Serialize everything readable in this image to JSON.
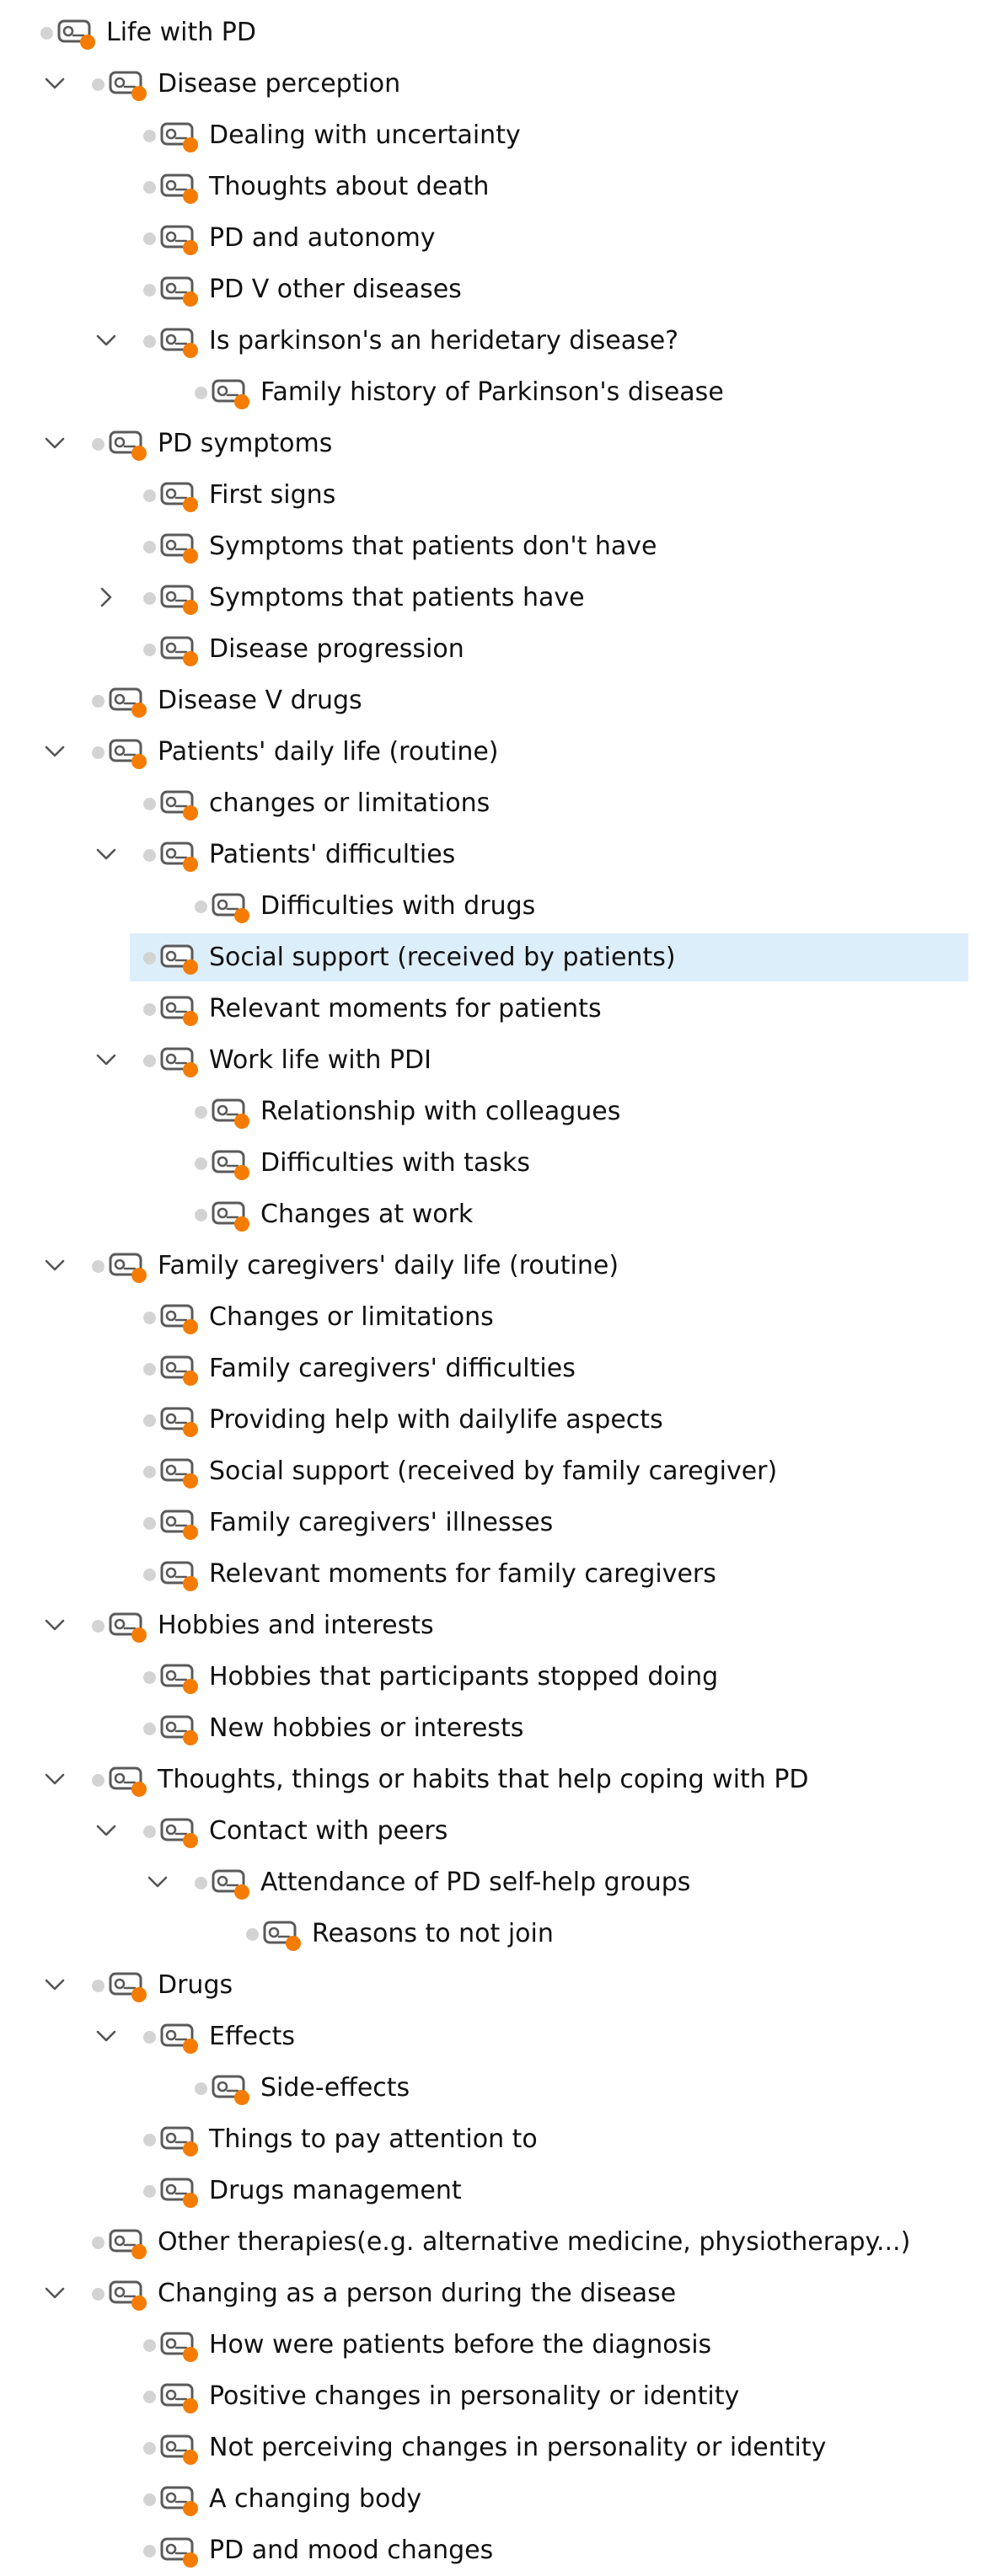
{
  "colors": {
    "code_badge_accent": "#f57c00",
    "selection_background": "#ddeefb",
    "status_dot": "#d3d3d3"
  },
  "icons": {
    "expand_chevron": "chevron-down-icon",
    "collapse_chevron": "chevron-right-icon",
    "code": "code-tag-icon",
    "status": "status-dot-icon"
  },
  "tree": [
    {
      "label": "Life with PD",
      "depth": 0,
      "toggle": "none"
    },
    {
      "label": "Disease perception",
      "depth": 1,
      "toggle": "expanded"
    },
    {
      "label": "Dealing with uncertainty",
      "depth": 2,
      "toggle": "none"
    },
    {
      "label": "Thoughts about death",
      "depth": 2,
      "toggle": "none"
    },
    {
      "label": "PD and autonomy",
      "depth": 2,
      "toggle": "none"
    },
    {
      "label": "PD V other diseases",
      "depth": 2,
      "toggle": "none"
    },
    {
      "label": "Is parkinson's an heridetary disease?",
      "depth": 2,
      "toggle": "expanded"
    },
    {
      "label": "Family history of Parkinson's disease",
      "depth": 3,
      "toggle": "none"
    },
    {
      "label": "PD symptoms",
      "depth": 1,
      "toggle": "expanded"
    },
    {
      "label": "First signs",
      "depth": 2,
      "toggle": "none"
    },
    {
      "label": "Symptoms that patients don't have",
      "depth": 2,
      "toggle": "none"
    },
    {
      "label": "Symptoms that patients have",
      "depth": 2,
      "toggle": "collapsed"
    },
    {
      "label": "Disease progression",
      "depth": 2,
      "toggle": "none"
    },
    {
      "label": "Disease V drugs",
      "depth": 1,
      "toggle": "none"
    },
    {
      "label": "Patients' daily life (routine)",
      "depth": 1,
      "toggle": "expanded"
    },
    {
      "label": "changes or limitations",
      "depth": 2,
      "toggle": "none"
    },
    {
      "label": "Patients' difficulties",
      "depth": 2,
      "toggle": "expanded"
    },
    {
      "label": "Difficulties with drugs",
      "depth": 3,
      "toggle": "none"
    },
    {
      "label": "Social support (received by patients)",
      "depth": 2,
      "toggle": "none",
      "selected": true
    },
    {
      "label": "Relevant moments for patients",
      "depth": 2,
      "toggle": "none"
    },
    {
      "label": "Work life with PDI",
      "depth": 2,
      "toggle": "expanded"
    },
    {
      "label": "Relationship with colleagues",
      "depth": 3,
      "toggle": "none"
    },
    {
      "label": "Difficulties with tasks",
      "depth": 3,
      "toggle": "none"
    },
    {
      "label": "Changes at work",
      "depth": 3,
      "toggle": "none"
    },
    {
      "label": "Family caregivers' daily life (routine)",
      "depth": 1,
      "toggle": "expanded"
    },
    {
      "label": "Changes or limitations",
      "depth": 2,
      "toggle": "none"
    },
    {
      "label": "Family caregivers' difficulties",
      "depth": 2,
      "toggle": "none"
    },
    {
      "label": "Providing help with dailylife aspects",
      "depth": 2,
      "toggle": "none"
    },
    {
      "label": "Social support (received by family caregiver)",
      "depth": 2,
      "toggle": "none"
    },
    {
      "label": "Family caregivers' illnesses",
      "depth": 2,
      "toggle": "none"
    },
    {
      "label": "Relevant moments for family caregivers",
      "depth": 2,
      "toggle": "none"
    },
    {
      "label": "Hobbies and interests",
      "depth": 1,
      "toggle": "expanded"
    },
    {
      "label": "Hobbies that participants stopped doing",
      "depth": 2,
      "toggle": "none"
    },
    {
      "label": "New hobbies or interests",
      "depth": 2,
      "toggle": "none"
    },
    {
      "label": "Thoughts, things or habits that help coping with PD",
      "depth": 1,
      "toggle": "expanded"
    },
    {
      "label": "Contact with peers",
      "depth": 2,
      "toggle": "expanded"
    },
    {
      "label": "Attendance of PD self-help groups",
      "depth": 3,
      "toggle": "expanded"
    },
    {
      "label": "Reasons to not join",
      "depth": 4,
      "toggle": "none"
    },
    {
      "label": "Drugs",
      "depth": 1,
      "toggle": "expanded"
    },
    {
      "label": "Effects",
      "depth": 2,
      "toggle": "expanded"
    },
    {
      "label": "Side-effects",
      "depth": 3,
      "toggle": "none"
    },
    {
      "label": "Things to pay attention to",
      "depth": 2,
      "toggle": "none"
    },
    {
      "label": "Drugs management",
      "depth": 2,
      "toggle": "none"
    },
    {
      "label": "Other therapies(e.g. alternative medicine, physiotherapy...)",
      "depth": 1,
      "toggle": "none"
    },
    {
      "label": "Changing as a person during the disease",
      "depth": 1,
      "toggle": "expanded"
    },
    {
      "label": "How were patients before the diagnosis",
      "depth": 2,
      "toggle": "none"
    },
    {
      "label": "Positive changes in personality or identity",
      "depth": 2,
      "toggle": "none"
    },
    {
      "label": "Not perceiving changes in personality or identity",
      "depth": 2,
      "toggle": "none"
    },
    {
      "label": "A changing body",
      "depth": 2,
      "toggle": "none"
    },
    {
      "label": "PD and mood changes",
      "depth": 2,
      "toggle": "none"
    }
  ]
}
